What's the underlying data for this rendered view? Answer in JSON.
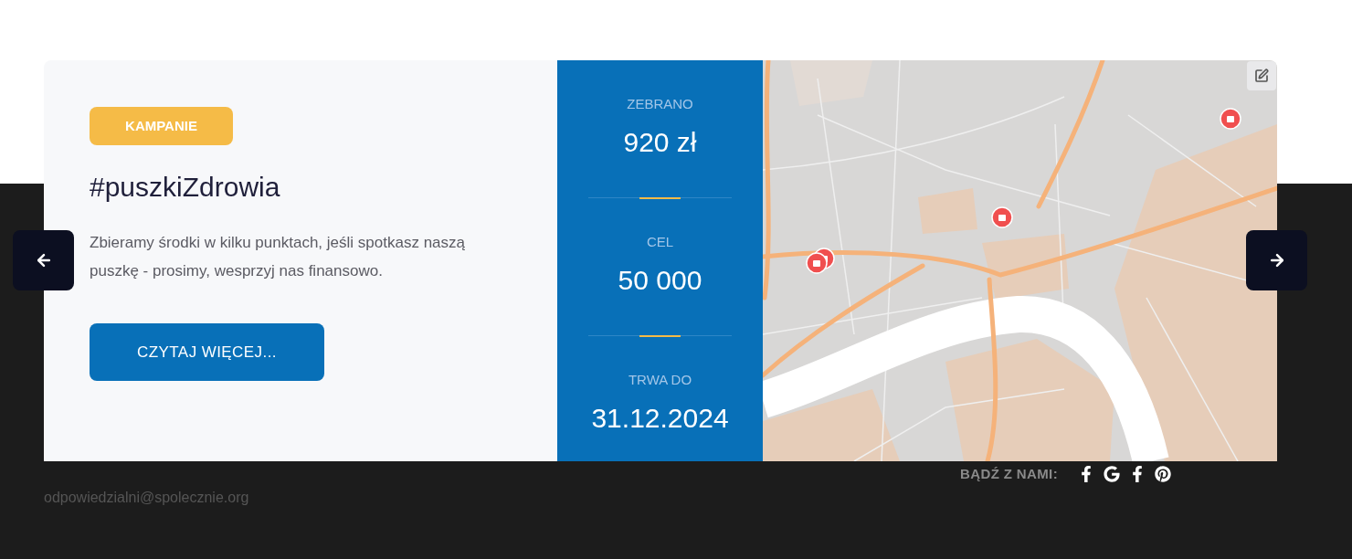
{
  "slide": {
    "category": "KAMPANIE",
    "title": "#puszkiZdrowia",
    "description": "Zbieramy środki w kilku punktach, jeśli spotkasz naszą puszkę - prosimy, wesprzyj nas finansowo.",
    "button": "CZYTAJ WIĘCEJ..."
  },
  "stats": [
    {
      "label": "ZEBRANO",
      "value": "920 zł"
    },
    {
      "label": "CEL",
      "value": "50 000"
    },
    {
      "label": "TRWA DO",
      "value": "31.12.2024"
    }
  ],
  "footer": {
    "email": "odpowiedzialni@spolecznie.org",
    "social_label": "BĄDŹ Z NAMI:"
  }
}
